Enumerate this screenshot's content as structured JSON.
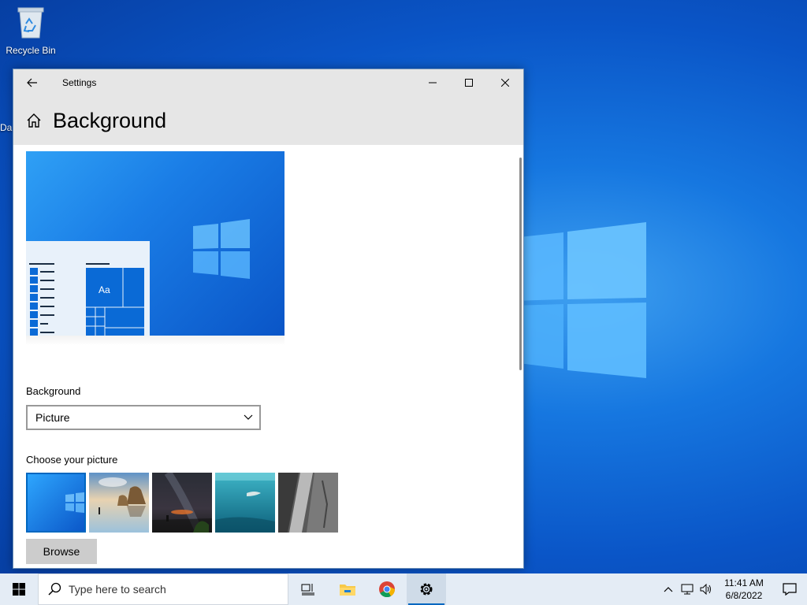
{
  "desktop": {
    "icons": [
      {
        "label": "Recycle Bin",
        "icon": "recycle-bin-icon"
      }
    ],
    "partial_icon_label": "Da"
  },
  "window": {
    "title": "Settings",
    "page_title": "Background",
    "preview": {
      "tile_label": "Aa"
    },
    "background_section": {
      "label": "Background",
      "selected": "Picture"
    },
    "choose_picture": {
      "label": "Choose your picture",
      "pictures": [
        {
          "name": "windows-default-wallpaper",
          "selected": true
        },
        {
          "name": "beach-rock-wallpaper",
          "selected": false
        },
        {
          "name": "night-sky-wallpaper",
          "selected": false
        },
        {
          "name": "underwater-wallpaper",
          "selected": false
        },
        {
          "name": "rock-cliff-wallpaper",
          "selected": false
        }
      ]
    },
    "browse_label": "Browse"
  },
  "taskbar": {
    "search_placeholder": "Type here to search",
    "apps": [
      {
        "name": "task-view-icon",
        "active": false
      },
      {
        "name": "file-explorer-icon",
        "active": false
      },
      {
        "name": "chrome-icon",
        "active": false
      },
      {
        "name": "settings-gear-icon",
        "active": true
      }
    ],
    "clock": {
      "time": "11:41 AM",
      "date": "6/8/2022"
    }
  },
  "colors": {
    "accent": "#0067c0",
    "desktop": "#0a55c7",
    "titlebar": "#e6e6e6",
    "taskbar": "#e4ecf5"
  }
}
